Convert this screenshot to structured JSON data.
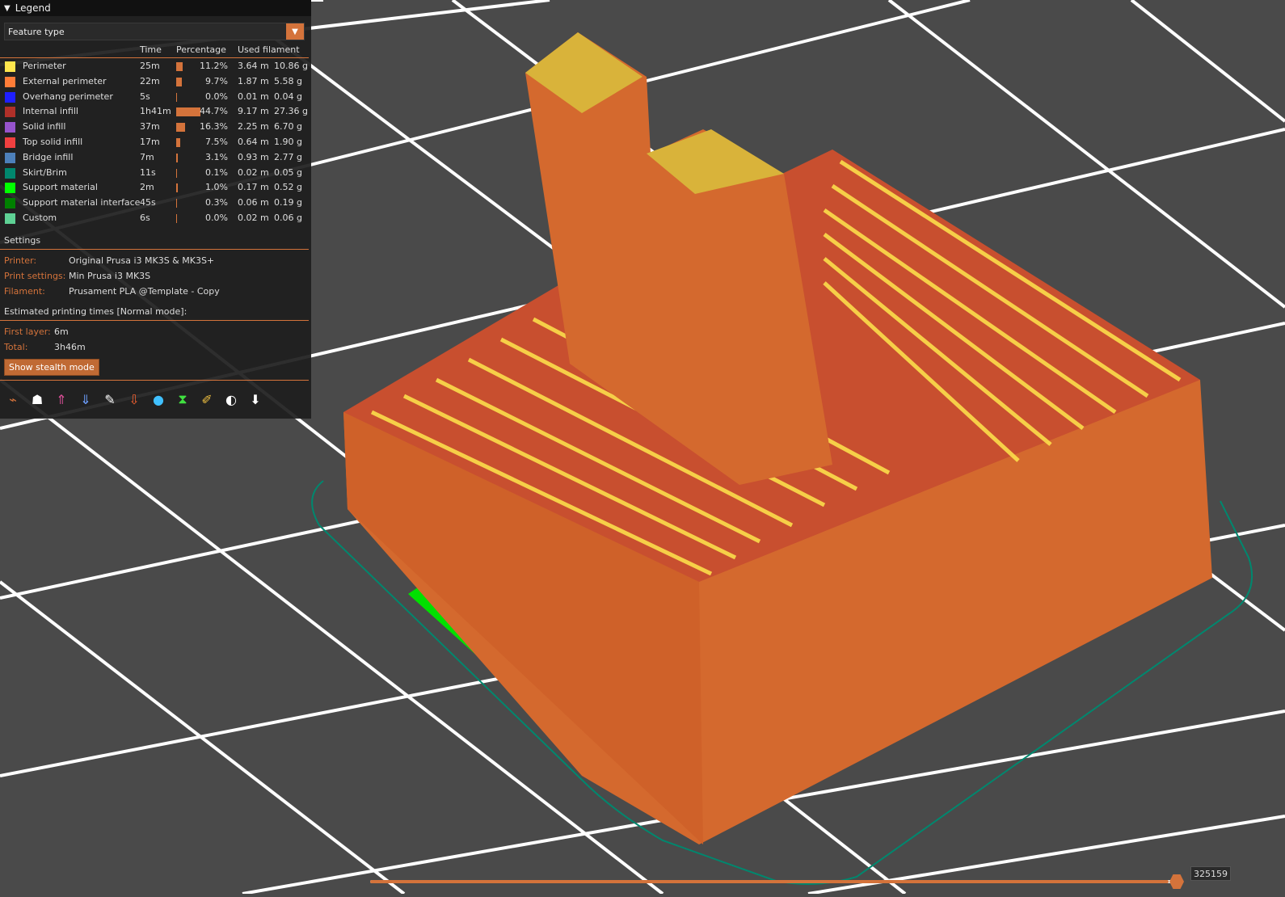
{
  "legend": {
    "title": "Legend",
    "view_type": "Feature type",
    "columns": {
      "time": "Time",
      "percentage": "Percentage",
      "filament": "Used filament"
    },
    "rows": [
      {
        "name": "Perimeter",
        "color": "#ffe64d",
        "time": "25m",
        "percent": "11.2%",
        "pct": 11.2,
        "length": "3.64 m",
        "weight": "10.86 g"
      },
      {
        "name": "External perimeter",
        "color": "#ff7d38",
        "time": "22m",
        "percent": "9.7%",
        "pct": 9.7,
        "length": "1.87 m",
        "weight": "5.58 g"
      },
      {
        "name": "Overhang perimeter",
        "color": "#1f1fff",
        "time": "5s",
        "percent": "0.0%",
        "pct": 0.0,
        "length": "0.01 m",
        "weight": "0.04 g"
      },
      {
        "name": "Internal infill",
        "color": "#b03029",
        "time": "1h41m",
        "percent": "44.7%",
        "pct": 44.7,
        "length": "9.17 m",
        "weight": "27.36 g"
      },
      {
        "name": "Solid infill",
        "color": "#9654cc",
        "time": "37m",
        "percent": "16.3%",
        "pct": 16.3,
        "length": "2.25 m",
        "weight": "6.70 g"
      },
      {
        "name": "Top solid infill",
        "color": "#f04040",
        "time": "17m",
        "percent": "7.5%",
        "pct": 7.5,
        "length": "0.64 m",
        "weight": "1.90 g"
      },
      {
        "name": "Bridge infill",
        "color": "#4d80ba",
        "time": "7m",
        "percent": "3.1%",
        "pct": 3.1,
        "length": "0.93 m",
        "weight": "2.77 g"
      },
      {
        "name": "Skirt/Brim",
        "color": "#00876e",
        "time": "11s",
        "percent": "0.1%",
        "pct": 0.1,
        "length": "0.02 m",
        "weight": "0.05 g"
      },
      {
        "name": "Support material",
        "color": "#00ff00",
        "time": "2m",
        "percent": "1.0%",
        "pct": 1.0,
        "length": "0.17 m",
        "weight": "0.52 g"
      },
      {
        "name": "Support material interface",
        "color": "#008000",
        "time": "45s",
        "percent": "0.3%",
        "pct": 0.3,
        "length": "0.06 m",
        "weight": "0.19 g"
      },
      {
        "name": "Custom",
        "color": "#5ed194",
        "time": "6s",
        "percent": "0.0%",
        "pct": 0.0,
        "length": "0.02 m",
        "weight": "0.06 g"
      }
    ],
    "settings": {
      "title": "Settings",
      "printer_label": "Printer:",
      "printer": "Original Prusa i3 MK3S & MK3S+",
      "print_label": "Print settings:",
      "print": "Min Prusa i3 MK3S",
      "filament_label": "Filament:",
      "filament": "Prusament PLA @Template - Copy"
    },
    "times": {
      "title": "Estimated printing times [Normal mode]:",
      "first_layer_label": "First layer:",
      "first_layer": "6m",
      "total_label": "Total:",
      "total": "3h46m"
    },
    "stealth_button": "Show stealth mode",
    "toolbar_icons": [
      "travel-icon",
      "wipe-icon",
      "retractions-icon",
      "deretractions-icon",
      "seams-icon",
      "tool-changes-icon",
      "color-changes-icon",
      "pause-prints-icon",
      "custom-gcodes-icon",
      "center-of-gravity-icon",
      "shells-icon"
    ]
  },
  "slider": {
    "value": "325159",
    "fraction": 0.99
  },
  "colors": {
    "accent": "#d4733b",
    "bed": "#4a4a4a",
    "grid": "#ffffff",
    "print_orange": "#d4692e"
  }
}
